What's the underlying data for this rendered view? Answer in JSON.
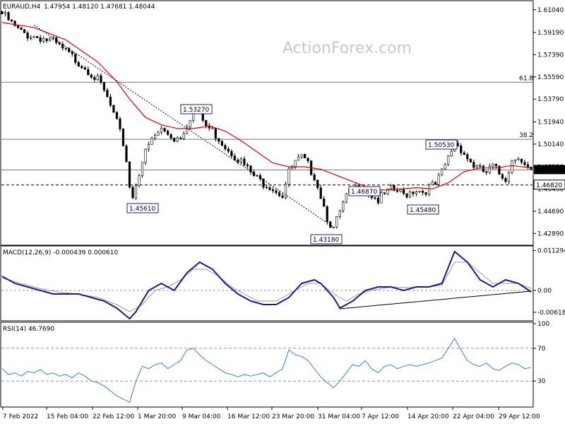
{
  "header": {
    "symbol": "EURAUD,H4",
    "ohlc": "1.47954 1.48120 1.47681 1.48044"
  },
  "watermark": "ActionForex.com",
  "colors": {
    "price": "#000000",
    "ma": "#e00000",
    "macd": "#1a1a8c",
    "signal": "#9a9a9a",
    "rsi": "#3a7fd5",
    "label_border": "#1f1f8f",
    "label_text": "#1f1f8f",
    "current_price_bg": "#000000"
  },
  "chart_data": [
    {
      "type": "candlestick",
      "title": "EURAUD,H4",
      "ylim": [
        1.4199,
        1.6166
      ],
      "y_ticks": [
        "1.61040",
        "1.59190",
        "1.57390",
        "1.55590",
        "1.53790",
        "1.51940",
        "1.50140",
        "1.48290",
        "1.46490",
        "1.44690",
        "1.42890"
      ],
      "current_price": "1.48044",
      "horizontal_levels": [
        {
          "value": 1.5516,
          "label": "61.8"
        },
        {
          "value": 1.5053,
          "label": "38.2"
        },
        {
          "value": 1.4804,
          "label": ""
        },
        {
          "value": 1.4682,
          "label": "1.46820",
          "style": "dashed"
        }
      ],
      "annotations": [
        {
          "text": "1.53270",
          "value": 1.5327
        },
        {
          "text": "1.45610",
          "value": 1.4561
        },
        {
          "text": "1.43180",
          "value": 1.4318
        },
        {
          "text": "1.46870",
          "value": 1.4687
        },
        {
          "text": "1.45480",
          "value": 1.4548
        },
        {
          "text": "1.50530",
          "value": 1.5053
        }
      ],
      "close_path": [
        [
          0,
          1.609
        ],
        [
          2,
          1.604
        ],
        [
          4,
          1.598
        ],
        [
          6,
          1.594
        ],
        [
          8,
          1.592
        ],
        [
          10,
          1.591
        ],
        [
          12,
          1.59
        ],
        [
          14,
          1.588
        ],
        [
          16,
          1.586
        ],
        [
          18,
          1.582
        ],
        [
          20,
          1.578
        ],
        [
          22,
          1.574
        ],
        [
          24,
          1.57
        ],
        [
          26,
          1.566
        ],
        [
          28,
          1.561
        ],
        [
          30,
          1.555
        ],
        [
          32,
          1.546
        ],
        [
          34,
          1.534
        ],
        [
          36,
          1.52
        ],
        [
          38,
          1.504
        ],
        [
          39,
          1.49
        ],
        [
          40,
          1.47
        ],
        [
          41,
          1.46
        ],
        [
          42,
          1.472
        ],
        [
          44,
          1.49
        ],
        [
          46,
          1.502
        ],
        [
          48,
          1.51
        ],
        [
          50,
          1.515
        ],
        [
          52,
          1.512
        ],
        [
          54,
          1.508
        ],
        [
          56,
          1.51
        ],
        [
          58,
          1.52
        ],
        [
          60,
          1.532
        ],
        [
          62,
          1.527
        ],
        [
          64,
          1.518
        ],
        [
          66,
          1.514
        ],
        [
          68,
          1.508
        ],
        [
          70,
          1.502
        ],
        [
          72,
          1.497
        ],
        [
          74,
          1.492
        ],
        [
          76,
          1.486
        ],
        [
          78,
          1.48
        ],
        [
          80,
          1.475
        ],
        [
          82,
          1.472
        ],
        [
          84,
          1.47
        ],
        [
          86,
          1.466
        ],
        [
          88,
          1.462
        ],
        [
          90,
          1.48
        ],
        [
          92,
          1.488
        ],
        [
          94,
          1.492
        ],
        [
          96,
          1.486
        ],
        [
          98,
          1.478
        ],
        [
          100,
          1.462
        ],
        [
          102,
          1.444
        ],
        [
          104,
          1.434
        ],
        [
          106,
          1.448
        ],
        [
          108,
          1.46
        ],
        [
          110,
          1.466
        ],
        [
          112,
          1.468
        ],
        [
          114,
          1.466
        ],
        [
          116,
          1.462
        ],
        [
          118,
          1.458
        ],
        [
          120,
          1.462
        ],
        [
          122,
          1.466
        ],
        [
          124,
          1.465
        ],
        [
          126,
          1.462
        ],
        [
          128,
          1.465
        ],
        [
          130,
          1.467
        ],
        [
          132,
          1.465
        ],
        [
          134,
          1.468
        ],
        [
          136,
          1.47
        ],
        [
          138,
          1.48
        ],
        [
          140,
          1.492
        ],
        [
          142,
          1.505
        ],
        [
          144,
          1.5
        ],
        [
          146,
          1.492
        ],
        [
          148,
          1.486
        ],
        [
          150,
          1.482
        ],
        [
          152,
          1.48
        ],
        [
          154,
          1.485
        ],
        [
          156,
          1.479
        ],
        [
          158,
          1.476
        ],
        [
          160,
          1.49
        ],
        [
          162,
          1.495
        ],
        [
          164,
          1.486
        ],
        [
          166,
          1.48
        ]
      ],
      "ma_path": [
        [
          0,
          1.6
        ],
        [
          10,
          1.596
        ],
        [
          20,
          1.586
        ],
        [
          30,
          1.568
        ],
        [
          36,
          1.552
        ],
        [
          40,
          1.538
        ],
        [
          45,
          1.523
        ],
        [
          50,
          1.517
        ],
        [
          55,
          1.514
        ],
        [
          60,
          1.514
        ],
        [
          65,
          1.516
        ],
        [
          70,
          1.512
        ],
        [
          75,
          1.504
        ],
        [
          80,
          1.495
        ],
        [
          85,
          1.486
        ],
        [
          90,
          1.483
        ],
        [
          95,
          1.483
        ],
        [
          100,
          1.481
        ],
        [
          105,
          1.476
        ],
        [
          110,
          1.471
        ],
        [
          115,
          1.466
        ],
        [
          120,
          1.464
        ],
        [
          125,
          1.465
        ],
        [
          130,
          1.466
        ],
        [
          135,
          1.465
        ],
        [
          140,
          1.47
        ],
        [
          145,
          1.479
        ],
        [
          150,
          1.482
        ],
        [
          155,
          1.482
        ],
        [
          160,
          1.484
        ],
        [
          166,
          1.482
        ]
      ],
      "trendlines": [
        {
          "from": [
            10,
            1.598
          ],
          "to": [
            104,
            1.434
          ],
          "style": "dotted"
        }
      ]
    },
    {
      "type": "line",
      "title": "MACD(12,26,9) -0.000439 0.000610",
      "ylim": [
        -0.0082,
        0.0122
      ],
      "y_ticks": [
        "0.011294",
        "0.00",
        "-0.00618"
      ],
      "series": [
        {
          "values": [
            [
              0,
              0.004
            ],
            [
              4,
              0.002
            ],
            [
              8,
              0.001
            ],
            [
              12,
              0.0
            ],
            [
              16,
              -0.001
            ],
            [
              20,
              -0.001
            ],
            [
              24,
              -0.001
            ],
            [
              28,
              -0.002
            ],
            [
              32,
              -0.003
            ],
            [
              36,
              -0.005
            ],
            [
              40,
              -0.008
            ],
            [
              42,
              -0.006
            ],
            [
              46,
              0.0
            ],
            [
              50,
              0.002
            ],
            [
              54,
              0.0
            ],
            [
              58,
              0.005
            ],
            [
              62,
              0.008
            ],
            [
              66,
              0.006
            ],
            [
              70,
              0.002
            ],
            [
              74,
              -0.001
            ],
            [
              78,
              -0.003
            ],
            [
              82,
              -0.004
            ],
            [
              86,
              -0.004
            ],
            [
              90,
              -0.002
            ],
            [
              94,
              0.002
            ],
            [
              98,
              0.003
            ],
            [
              100,
              0.002
            ],
            [
              104,
              -0.002
            ],
            [
              106,
              -0.005
            ],
            [
              110,
              -0.003
            ],
            [
              114,
              0.0
            ],
            [
              118,
              0.001
            ],
            [
              122,
              0.001
            ],
            [
              126,
              0.0
            ],
            [
              130,
              0.001
            ],
            [
              134,
              0.001
            ],
            [
              138,
              0.002
            ],
            [
              142,
              0.011
            ],
            [
              146,
              0.008
            ],
            [
              150,
              0.003
            ],
            [
              154,
              0.001
            ],
            [
              158,
              0.003
            ],
            [
              162,
              0.002
            ],
            [
              166,
              -0.0004
            ]
          ]
        },
        {
          "values": [
            [
              0,
              0.0035
            ],
            [
              6,
              0.002
            ],
            [
              12,
              0.0005
            ],
            [
              18,
              -0.0005
            ],
            [
              24,
              -0.001
            ],
            [
              30,
              -0.002
            ],
            [
              36,
              -0.004
            ],
            [
              40,
              -0.006
            ],
            [
              44,
              -0.004
            ],
            [
              48,
              0.0
            ],
            [
              52,
              0.001
            ],
            [
              56,
              0.003
            ],
            [
              60,
              0.006
            ],
            [
              64,
              0.006
            ],
            [
              68,
              0.004
            ],
            [
              72,
              0.001
            ],
            [
              76,
              -0.001
            ],
            [
              80,
              -0.003
            ],
            [
              86,
              -0.003
            ],
            [
              92,
              0.0
            ],
            [
              96,
              0.002
            ],
            [
              100,
              0.002
            ],
            [
              104,
              -0.001
            ],
            [
              108,
              -0.003
            ],
            [
              112,
              -0.001
            ],
            [
              116,
              0.0
            ],
            [
              122,
              0.001
            ],
            [
              128,
              0.0008
            ],
            [
              134,
              0.001
            ],
            [
              138,
              0.0015
            ],
            [
              142,
              0.008
            ],
            [
              146,
              0.008
            ],
            [
              150,
              0.005
            ],
            [
              154,
              0.002
            ],
            [
              158,
              0.002
            ],
            [
              162,
              0.002
            ],
            [
              166,
              0.0006
            ]
          ]
        }
      ],
      "trendlines": [
        {
          "from": [
            106,
            -0.0052
          ],
          "to": [
            166,
            -0.0002
          ],
          "style": "solid"
        }
      ]
    },
    {
      "type": "line",
      "title": "RSI(14) 46.7690",
      "ylim": [
        0,
        100
      ],
      "y_ticks": [
        "100",
        "70",
        "30"
      ],
      "levels": [
        70,
        30
      ],
      "x_ticks": [
        "7 Feb 2022",
        "15 Feb 04:00",
        "22 Feb 12:00",
        "1 Mar 20:00",
        "9 Mar 04:00",
        "16 Mar 12:00",
        "23 Mar 20:00",
        "31 Mar 04:00",
        "7 Apr 12:00",
        "14 Apr 20:00",
        "22 Apr 04:00",
        "29 Apr 12:00"
      ],
      "series": [
        {
          "values": [
            [
              0,
              45
            ],
            [
              2,
              38
            ],
            [
              4,
              40
            ],
            [
              6,
              36
            ],
            [
              8,
              42
            ],
            [
              10,
              40
            ],
            [
              12,
              44
            ],
            [
              14,
              38
            ],
            [
              16,
              40
            ],
            [
              18,
              36
            ],
            [
              20,
              38
            ],
            [
              22,
              34
            ],
            [
              24,
              40
            ],
            [
              26,
              36
            ],
            [
              28,
              30
            ],
            [
              30,
              28
            ],
            [
              32,
              24
            ],
            [
              34,
              18
            ],
            [
              36,
              12
            ],
            [
              38,
              8
            ],
            [
              40,
              4
            ],
            [
              42,
              30
            ],
            [
              44,
              48
            ],
            [
              46,
              45
            ],
            [
              48,
              50
            ],
            [
              50,
              52
            ],
            [
              52,
              45
            ],
            [
              54,
              50
            ],
            [
              56,
              55
            ],
            [
              58,
              68
            ],
            [
              60,
              70
            ],
            [
              62,
              62
            ],
            [
              64,
              55
            ],
            [
              66,
              50
            ],
            [
              68,
              45
            ],
            [
              70,
              40
            ],
            [
              72,
              38
            ],
            [
              74,
              35
            ],
            [
              76,
              38
            ],
            [
              78,
              36
            ],
            [
              80,
              38
            ],
            [
              82,
              40
            ],
            [
              84,
              35
            ],
            [
              86,
              40
            ],
            [
              88,
              45
            ],
            [
              90,
              68
            ],
            [
              92,
              62
            ],
            [
              94,
              60
            ],
            [
              96,
              55
            ],
            [
              98,
              45
            ],
            [
              100,
              35
            ],
            [
              102,
              28
            ],
            [
              104,
              22
            ],
            [
              106,
              30
            ],
            [
              108,
              40
            ],
            [
              110,
              50
            ],
            [
              112,
              48
            ],
            [
              114,
              55
            ],
            [
              116,
              45
            ],
            [
              118,
              40
            ],
            [
              120,
              48
            ],
            [
              122,
              50
            ],
            [
              124,
              45
            ],
            [
              126,
              48
            ],
            [
              128,
              50
            ],
            [
              130,
              48
            ],
            [
              132,
              50
            ],
            [
              134,
              52
            ],
            [
              136,
              55
            ],
            [
              138,
              58
            ],
            [
              140,
              70
            ],
            [
              142,
              82
            ],
            [
              144,
              68
            ],
            [
              146,
              55
            ],
            [
              148,
              50
            ],
            [
              150,
              48
            ],
            [
              152,
              52
            ],
            [
              154,
              45
            ],
            [
              156,
              43
            ],
            [
              158,
              48
            ],
            [
              160,
              52
            ],
            [
              162,
              50
            ],
            [
              164,
              45
            ],
            [
              166,
              46.769
            ]
          ]
        }
      ]
    }
  ]
}
